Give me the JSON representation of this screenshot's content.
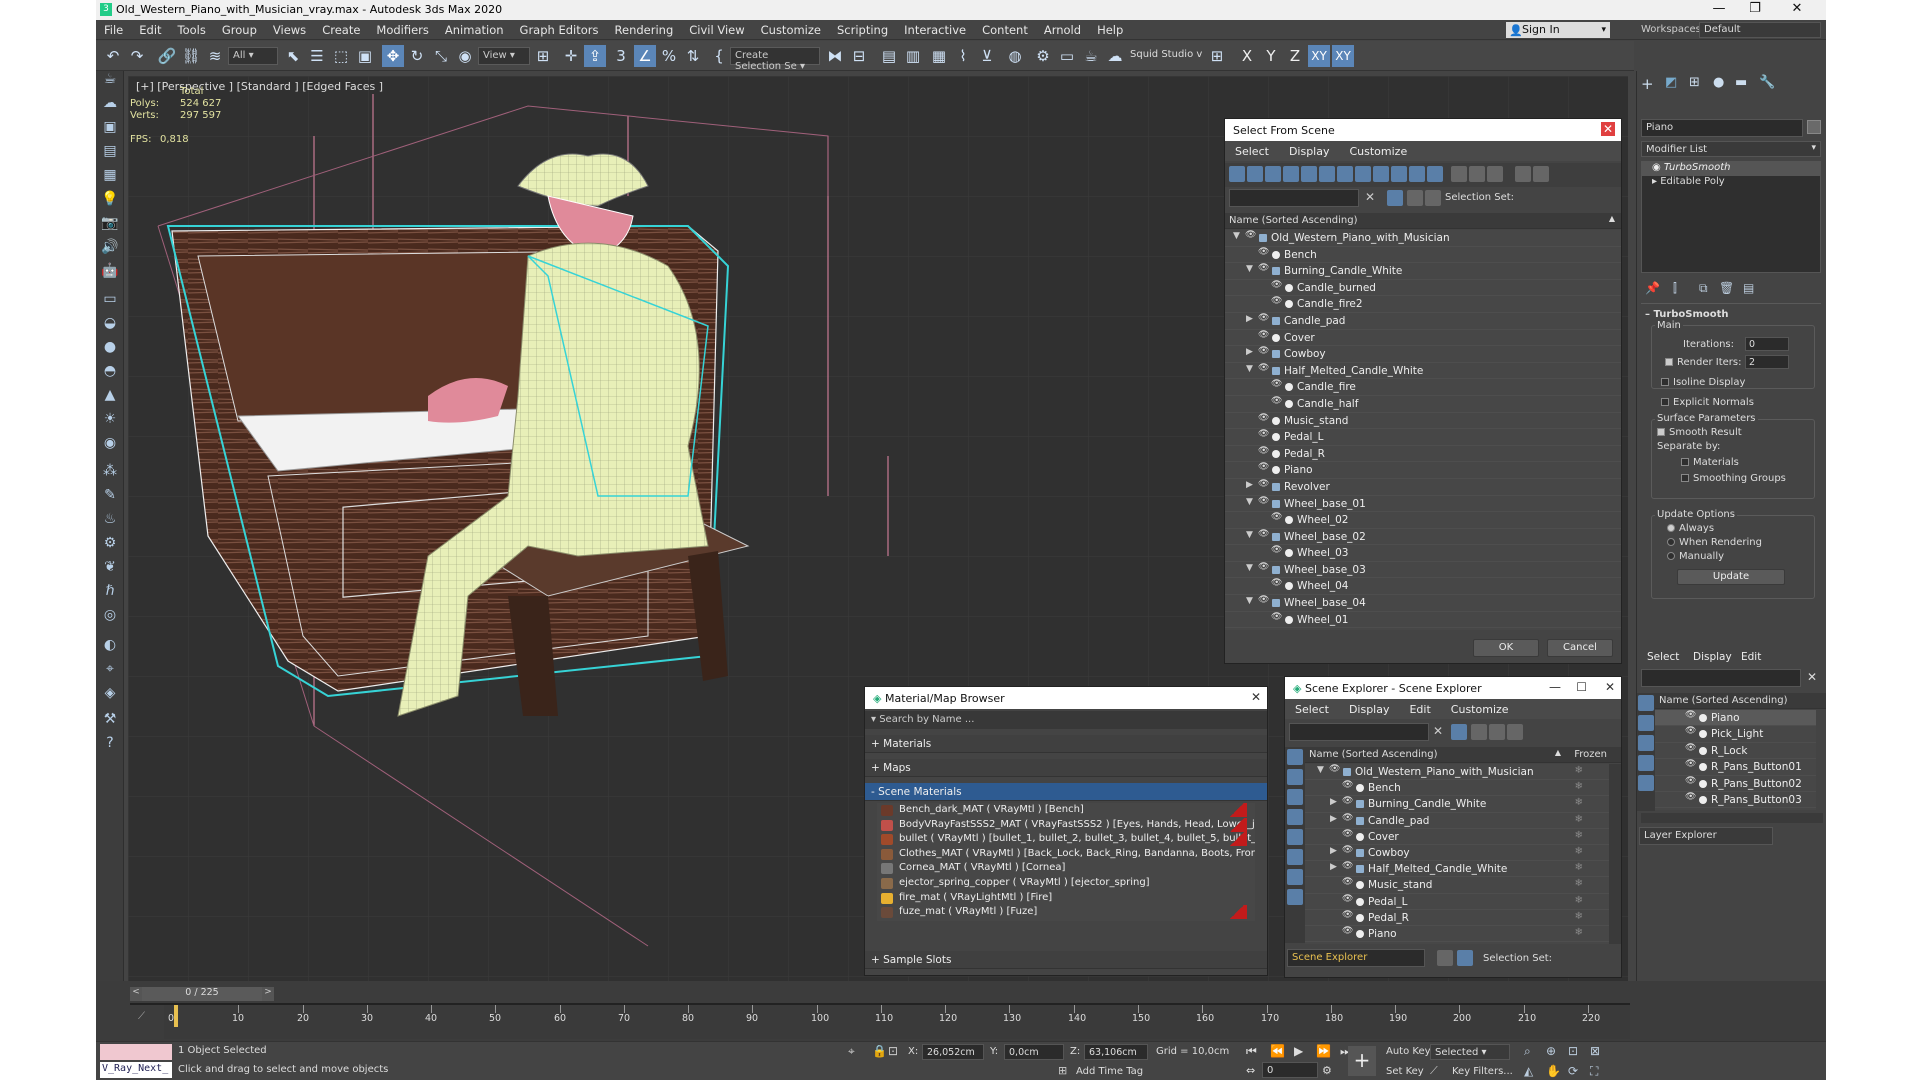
{
  "app": {
    "title": "Old_Western_Piano_with_Musician_vray.max - Autodesk 3ds Max 2020"
  },
  "menu": [
    "File",
    "Edit",
    "Tools",
    "Group",
    "Views",
    "Create",
    "Modifiers",
    "Animation",
    "Graph Editors",
    "Rendering",
    "Civil View",
    "Customize",
    "Scripting",
    "Interactive",
    "Content",
    "Arnold",
    "Help"
  ],
  "signin": {
    "label": "Sign In"
  },
  "workspace": {
    "label": "Workspaces:",
    "value": "Default"
  },
  "toolbar": {
    "filter": "All",
    "refcoord": "View",
    "named_sel": "Create Selection Se",
    "studio": "Squid Studio v",
    "axes": [
      "X",
      "Y",
      "Z",
      "XY",
      "XY"
    ],
    "num3": "3"
  },
  "viewport": {
    "label": "[+] [Perspective ] [Standard ] [Edged Faces ]",
    "stats": {
      "total": "Total",
      "polys_label": "Polys:",
      "polys": "524 627",
      "verts_label": "Verts:",
      "verts": "297 597",
      "fps_label": "FPS:",
      "fps": "0,818"
    }
  },
  "select_from_scene": {
    "title": "Select From Scene",
    "tabs": [
      "Select",
      "Display",
      "Customize"
    ],
    "selection_set_label": "Selection Set:",
    "column": "Name (Sorted Ascending)",
    "rows": [
      {
        "name": "Old_Western_Piano_with_Musician",
        "level": 0,
        "exp": "open",
        "grp": true
      },
      {
        "name": "Bench",
        "level": 1,
        "exp": "",
        "grp": false
      },
      {
        "name": "Burning_Candle_White",
        "level": 1,
        "exp": "open",
        "grp": true
      },
      {
        "name": "Candle_burned",
        "level": 2,
        "exp": "",
        "grp": false
      },
      {
        "name": "Candle_fire2",
        "level": 2,
        "exp": "",
        "grp": false
      },
      {
        "name": "Candle_pad",
        "level": 1,
        "exp": "closed",
        "grp": true
      },
      {
        "name": "Cover",
        "level": 1,
        "exp": "",
        "grp": false
      },
      {
        "name": "Cowboy",
        "level": 1,
        "exp": "closed",
        "grp": true
      },
      {
        "name": "Half_Melted_Candle_White",
        "level": 1,
        "exp": "open",
        "grp": true
      },
      {
        "name": "Candle_fire",
        "level": 2,
        "exp": "",
        "grp": false
      },
      {
        "name": "Candle_half",
        "level": 2,
        "exp": "",
        "grp": false
      },
      {
        "name": "Music_stand",
        "level": 1,
        "exp": "",
        "grp": false
      },
      {
        "name": "Pedal_L",
        "level": 1,
        "exp": "",
        "grp": false
      },
      {
        "name": "Pedal_R",
        "level": 1,
        "exp": "",
        "grp": false
      },
      {
        "name": "Piano",
        "level": 1,
        "exp": "",
        "grp": false
      },
      {
        "name": "Revolver",
        "level": 1,
        "exp": "closed",
        "grp": true
      },
      {
        "name": "Wheel_base_01",
        "level": 1,
        "exp": "open",
        "grp": true
      },
      {
        "name": "Wheel_02",
        "level": 2,
        "exp": "",
        "grp": false
      },
      {
        "name": "Wheel_base_02",
        "level": 1,
        "exp": "open",
        "grp": true
      },
      {
        "name": "Wheel_03",
        "level": 2,
        "exp": "",
        "grp": false
      },
      {
        "name": "Wheel_base_03",
        "level": 1,
        "exp": "open",
        "grp": true
      },
      {
        "name": "Wheel_04",
        "level": 2,
        "exp": "",
        "grp": false
      },
      {
        "name": "Wheel_base_04",
        "level": 1,
        "exp": "open",
        "grp": true
      },
      {
        "name": "Wheel_01",
        "level": 2,
        "exp": "",
        "grp": false
      }
    ],
    "ok": "OK",
    "cancel": "Cancel"
  },
  "material_browser": {
    "title": "Material/Map Browser",
    "search": "Search by Name ...",
    "sections": [
      "+ Materials",
      "+ Maps",
      "- Scene Materials",
      "+ Sample Slots"
    ],
    "items": [
      {
        "text": "Bench_dark_MAT  ( VRayMtl )  [Bench]",
        "color": "#6b3a2a",
        "red": true
      },
      {
        "text": "BodyVRayFastSSS2_MAT  ( VRayFastSSS2 )  [Eyes, Hands, Head, Lower_jaw...",
        "color": "#c0504a",
        "red": true
      },
      {
        "text": "bullet  ( VRayMtl )  [bullet_1, bullet_2, bullet_3, bullet_4, bullet_5, bullet_6]",
        "color": "#a04a2a",
        "red": true
      },
      {
        "text": "Clothes_MAT  ( VRayMtl )  [Back_Lock, Back_Ring, Bandanna, Boots, Front_...",
        "color": "#8a5a3a",
        "red": false
      },
      {
        "text": "Cornea_MAT  ( VRayMtl )  [Cornea]",
        "color": "#777777",
        "red": false
      },
      {
        "text": "ejector_spring_copper  ( VRayMtl )  [ejector_spring]",
        "color": "#8a6a4a",
        "red": false
      },
      {
        "text": "fire_mat  ( VRayLightMtl )  [Fire]",
        "color": "#e8b030",
        "red": false
      },
      {
        "text": "fuze_mat  ( VRayMtl )  [Fuze]",
        "color": "#6a4a3a",
        "red": true
      }
    ]
  },
  "scene_explorer": {
    "title": "Scene Explorer - Scene Explorer",
    "tabs": [
      "Select",
      "Display",
      "Edit",
      "Customize"
    ],
    "column": "Name (Sorted Ascending)",
    "frozen": "Frozen",
    "rows": [
      {
        "name": "Old_Western_Piano_with_Musician",
        "level": 0,
        "exp": "open",
        "grp": true
      },
      {
        "name": "Bench",
        "level": 1,
        "exp": "",
        "grp": false
      },
      {
        "name": "Burning_Candle_White",
        "level": 1,
        "exp": "closed",
        "grp": true
      },
      {
        "name": "Candle_pad",
        "level": 1,
        "exp": "closed",
        "grp": true
      },
      {
        "name": "Cover",
        "level": 1,
        "exp": "",
        "grp": false
      },
      {
        "name": "Cowboy",
        "level": 1,
        "exp": "closed",
        "grp": true
      },
      {
        "name": "Half_Melted_Candle_White",
        "level": 1,
        "exp": "closed",
        "grp": true
      },
      {
        "name": "Music_stand",
        "level": 1,
        "exp": "",
        "grp": false
      },
      {
        "name": "Pedal_L",
        "level": 1,
        "exp": "",
        "grp": false
      },
      {
        "name": "Pedal_R",
        "level": 1,
        "exp": "",
        "grp": false
      },
      {
        "name": "Piano",
        "level": 1,
        "exp": "",
        "grp": false
      }
    ],
    "footer_name": "Scene Explorer",
    "selection_set_label": "Selection Set:"
  },
  "command_panel": {
    "object_name": "Piano",
    "modifier_list": "Modifier List",
    "stack": [
      "TurboSmooth",
      "Editable Poly"
    ],
    "rollout": "TurboSmooth",
    "main": "Main",
    "iterations_label": "Iterations:",
    "iterations": "0",
    "render_iters_label": "Render Iters:",
    "render_iters": "2",
    "isoline": "Isoline Display",
    "explicit": "Explicit Normals",
    "surface": "Surface Parameters",
    "smooth": "Smooth Result",
    "separate": "Separate by:",
    "materials": "Materials",
    "smoothing": "Smoothing Groups",
    "update_options": "Update Options",
    "always": "Always",
    "when_rendering": "When Rendering",
    "manually": "Manually",
    "update": "Update"
  },
  "layer_explorer": {
    "tabs": [
      "Select",
      "Display",
      "Edit"
    ],
    "column": "Name (Sorted Ascending)",
    "rows": [
      "Piano",
      "Pick_Light",
      "R_Lock",
      "R_Pans_Button01",
      "R_Pans_Button02",
      "R_Pans_Button03"
    ],
    "footer": "Layer Explorer"
  },
  "timeline": {
    "frame": "0 / 225",
    "ticks": [
      "0",
      "10",
      "20",
      "30",
      "40",
      "50",
      "60",
      "70",
      "80",
      "90",
      "100",
      "110",
      "120",
      "130",
      "140",
      "150",
      "160",
      "170",
      "180",
      "190",
      "200",
      "210",
      "220"
    ]
  },
  "status": {
    "maxscript": "V_Ray_Next_",
    "selected": "1 Object Selected",
    "prompt": "Click and drag to select and move objects",
    "x_label": "X:",
    "x": "26,052cm",
    "y_label": "Y:",
    "y": "0,0cm",
    "z_label": "Z:",
    "z": "63,106cm",
    "grid": "Grid = 10,0cm",
    "add_time_tag": "Add Time Tag",
    "auto_key": "Auto Key",
    "set_key": "Set Key",
    "selected_drop": "Selected",
    "key_filters": "Key Filters...",
    "frame": "0"
  }
}
